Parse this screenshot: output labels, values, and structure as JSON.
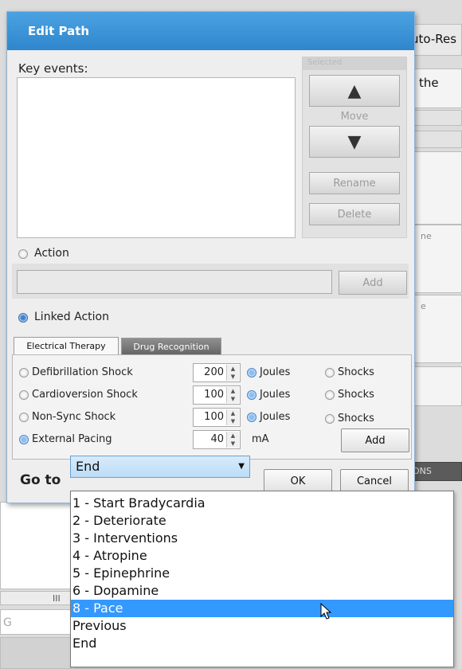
{
  "background": {
    "title_fragment": "uto-Res",
    "field_fragment": "the",
    "side_label_1": "ne",
    "side_label_2": "e",
    "tab_fragment": "ONS",
    "scroll_glyph": "III",
    "input_fragment": "G"
  },
  "dialog": {
    "title": "Edit Path",
    "key_events_label": "Key events:",
    "key_events_items": [],
    "selected_group": {
      "title": "Selected",
      "move_label": "Move",
      "up_glyph": "▲",
      "down_glyph": "▼",
      "rename_label": "Rename",
      "delete_label": "Delete"
    },
    "action": {
      "label": "Action",
      "selected": false,
      "input_value": "",
      "add_label": "Add"
    },
    "linked_action": {
      "label": "Linked Action",
      "selected": true
    },
    "tabs": [
      {
        "label": "Electrical Therapy",
        "active": true
      },
      {
        "label": "Drug Recognition",
        "active": false
      }
    ],
    "therapy_rows": [
      {
        "label": "Defibrillation Shock",
        "value": "200",
        "unit": "Joules",
        "alt_label": "Shocks",
        "selected": false
      },
      {
        "label": "Cardioversion Shock",
        "value": "100",
        "unit": "Joules",
        "alt_label": "Shocks",
        "selected": false
      },
      {
        "label": "Non-Sync Shock",
        "value": "100",
        "unit": "Joules",
        "alt_label": "Shocks",
        "selected": false
      },
      {
        "label": "External Pacing",
        "value": "40",
        "unit": "mA",
        "selected": true
      }
    ],
    "therapy_add_label": "Add",
    "goto_label": "Go to",
    "goto_value": "End",
    "combo_arrow_glyph": "▼",
    "ok_label": "OK",
    "cancel_label": "Cancel"
  },
  "dropdown": {
    "options": [
      "1 - Start Bradycardia",
      "2 - Deteriorate",
      "3 - Interventions",
      "4 - Atropine",
      "5 - Epinephrine",
      "6 - Dopamine",
      "8 - Pace",
      "Previous",
      "End"
    ],
    "selected_index": 6
  },
  "colors": {
    "title_bar": "#3a95d8",
    "selection": "#3399ff"
  }
}
